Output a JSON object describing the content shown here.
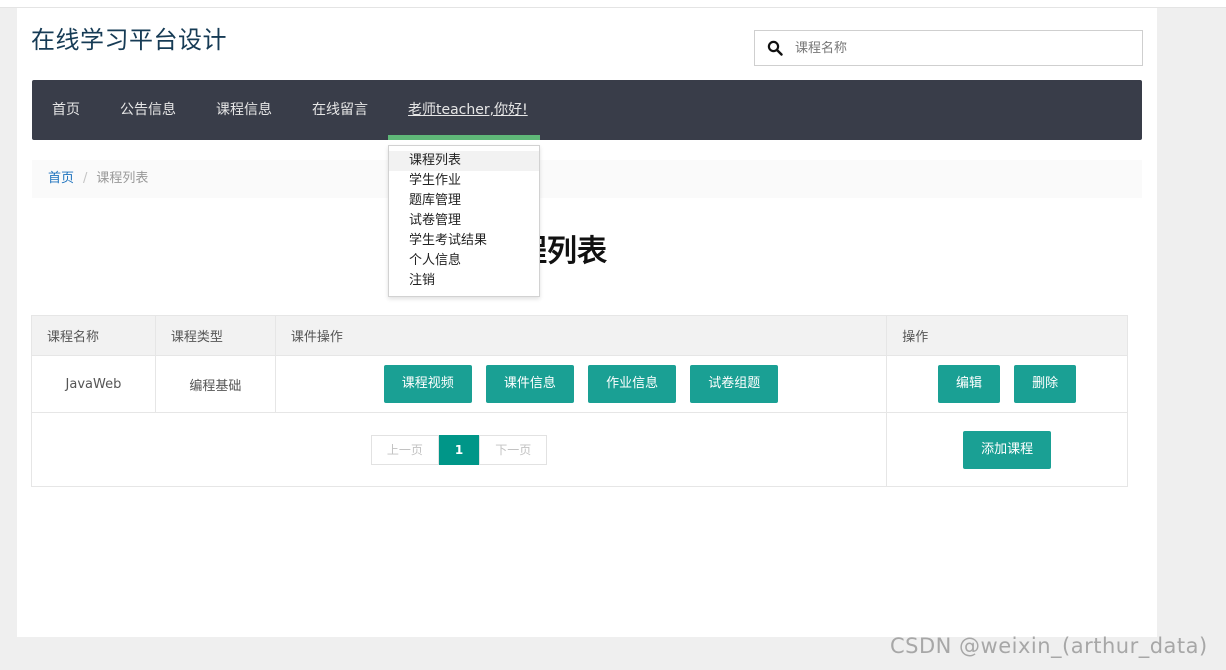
{
  "site": {
    "title": "在线学习平台设计"
  },
  "search": {
    "placeholder": "课程名称"
  },
  "nav": {
    "items": [
      {
        "label": "首页"
      },
      {
        "label": "公告信息"
      },
      {
        "label": "课程信息"
      },
      {
        "label": "在线留言"
      }
    ],
    "user_label": "老师teacher,你好!"
  },
  "dropdown": {
    "items": [
      "课程列表",
      "学生作业",
      "题库管理",
      "试卷管理",
      "学生考试结果",
      "个人信息",
      "注销"
    ],
    "active": "课程列表"
  },
  "breadcrumb": {
    "home": "首页",
    "separator": "/",
    "current": "课程列表"
  },
  "page_heading": "课程列表",
  "table": {
    "headers": [
      "课程名称",
      "课程类型",
      "课件操作",
      "操作"
    ],
    "rows": [
      {
        "name": "JavaWeb",
        "type": "编程基础",
        "course_actions": [
          "课程视频",
          "课件信息",
          "作业信息",
          "试卷组题"
        ],
        "ops": [
          "编辑",
          "删除"
        ]
      }
    ]
  },
  "pagination": {
    "prev": "上一页",
    "current": "1",
    "next": "下一页"
  },
  "add_button": "添加课程",
  "watermark": "CSDN @weixin_(arthur_data)",
  "colors": {
    "nav_bg": "#393d49",
    "accent": "#1aa094",
    "nav_active_bar": "#5fb878",
    "pager_current": "#009688"
  }
}
